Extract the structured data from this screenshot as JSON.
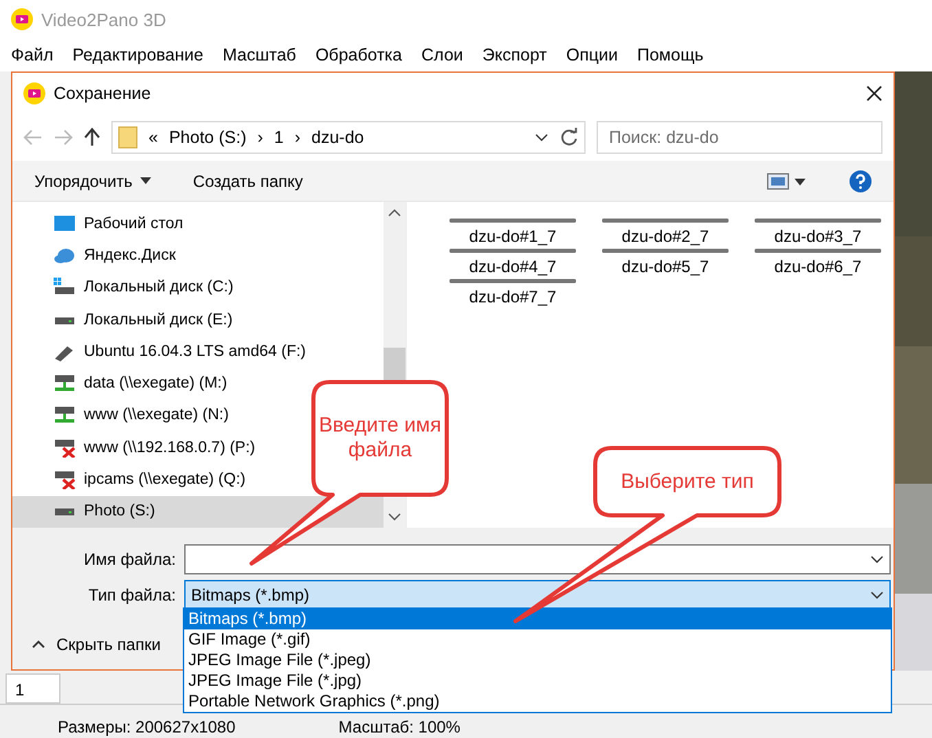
{
  "window": {
    "title": "Video2Pano 3D"
  },
  "menu": [
    "Файл",
    "Редактирование",
    "Масштаб",
    "Обработка",
    "Слои",
    "Экспорт",
    "Опции",
    "Помощь"
  ],
  "dialog": {
    "title": "Сохранение",
    "breadcrumb": [
      "«",
      "Photo (S:)",
      "›",
      "1",
      "›",
      "dzu-do"
    ],
    "search": {
      "placeholder": "Поиск: dzu-do"
    },
    "toolbar": {
      "organize": "Упорядочить",
      "new_folder": "Создать папку"
    },
    "nav_items": [
      {
        "label": "Рабочий стол",
        "kind": "desktop",
        "selected": false
      },
      {
        "label": "Яндекс.Диск",
        "kind": "cloud",
        "selected": false
      },
      {
        "label": "Локальный диск (C:)",
        "kind": "system",
        "selected": false
      },
      {
        "label": "Локальный диск (E:)",
        "kind": "drive",
        "selected": false
      },
      {
        "label": "Ubuntu 16.04.3 LTS amd64 (F:)",
        "kind": "usb",
        "selected": false
      },
      {
        "label": "data (\\\\exegate) (M:)",
        "kind": "network",
        "selected": false
      },
      {
        "label": "www (\\\\exegate) (N:)",
        "kind": "network",
        "selected": false
      },
      {
        "label": "www (\\\\192.168.0.7) (P:)",
        "kind": "offline",
        "selected": false
      },
      {
        "label": "ipcams (\\\\exegate) (Q:)",
        "kind": "offline",
        "selected": false
      },
      {
        "label": "Photo (S:)",
        "kind": "drive",
        "selected": true
      }
    ],
    "files": [
      "dzu-do#1_7",
      "dzu-do#2_7",
      "dzu-do#3_7",
      "dzu-do#4_7",
      "dzu-do#5_7",
      "dzu-do#6_7",
      "dzu-do#7_7"
    ],
    "filename": {
      "label": "Имя файла:"
    },
    "filetype": {
      "label": "Тип файла:",
      "value": "Bitmaps (*.bmp)",
      "options": [
        {
          "label": "Bitmaps (*.bmp)",
          "selected": true
        },
        {
          "label": "GIF Image (*.gif)",
          "selected": false
        },
        {
          "label": "JPEG Image File (*.jpeg)",
          "selected": false
        },
        {
          "label": "JPEG Image File (*.jpg)",
          "selected": false
        },
        {
          "label": "Portable Network Graphics (*.png)",
          "selected": false
        }
      ]
    },
    "hide_folders": "Скрыть папки"
  },
  "layer_tab": "1",
  "status": [
    "Размеры: 200627x1080",
    "Масштаб: 100%"
  ],
  "callouts": [
    "Введите имя файла",
    "Выберите тип"
  ]
}
